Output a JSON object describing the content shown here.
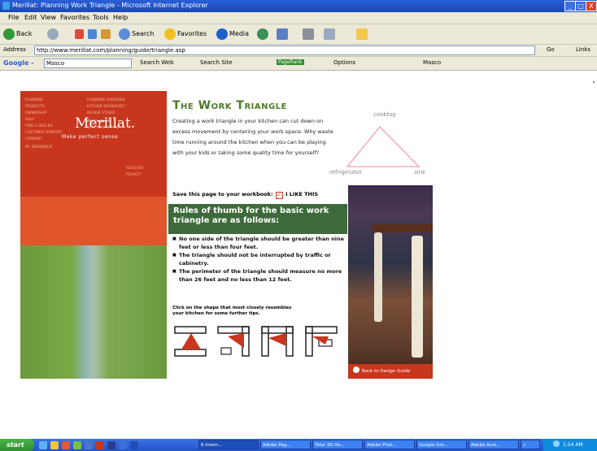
{
  "window": {
    "title": "Merillat: Planning Work Triangle - Microsoft Internet Explorer",
    "controls": [
      "_",
      "□",
      "X"
    ]
  },
  "menu": [
    "File",
    "Edit",
    "View",
    "Favorites",
    "Tools",
    "Help"
  ],
  "toolbar": {
    "back": "Back",
    "search": "Search",
    "favorites": "Favorites",
    "media": "Media"
  },
  "address": {
    "label": "Address",
    "url": "http://www.merillat.com/planning/guide/triangle.asp",
    "go": "Go",
    "links": "Links"
  },
  "googlebar": {
    "label": "Google -",
    "query": "Masco",
    "search_web": "Search Web",
    "search_site": "Search Site",
    "pagerank": "PageRank",
    "options": "Options",
    "masco": "Masco"
  },
  "page": {
    "brand": "Merillat.",
    "tagline": "Make perfect sense",
    "title": "The Work Triangle",
    "intro": "Creating a work triangle in your kitchen can cut down on excess movement by centering your work space. Why waste time running around the kitchen when you can be playing with your kids or taking some quality time for yourself?",
    "triangle": {
      "top": "cooktop",
      "left": "refrigerator",
      "right": "sink"
    },
    "save_label": "Save this page to your workbook:",
    "like_label": "I LIKE THIS",
    "rules_heading": "Rules of thumb for the basic work triangle are as follows:",
    "rules": [
      "No one side of the triangle should be greater than nine feet or less than four feet.",
      "The triangle should not be interrupted by traffic or cabinetry.",
      "The perimeter of the triangle should measure no more than 26 feet and no less than 12 feet."
    ],
    "click_text": "Click on the shape that most closely resembles your kitchen for some further tips.",
    "back_link": "Back to Design Guide",
    "accent_red": "#c8361d",
    "accent_green": "#4d7a2a"
  },
  "taskbar": {
    "start": "start",
    "tasks": [
      "6 Intern...",
      "Adobe Pag...",
      "Total 3D Ho...",
      "Adobe Phot...",
      "Google Gro...",
      "Adobe Acro...",
      "«"
    ],
    "clock": "1:54 AM"
  }
}
